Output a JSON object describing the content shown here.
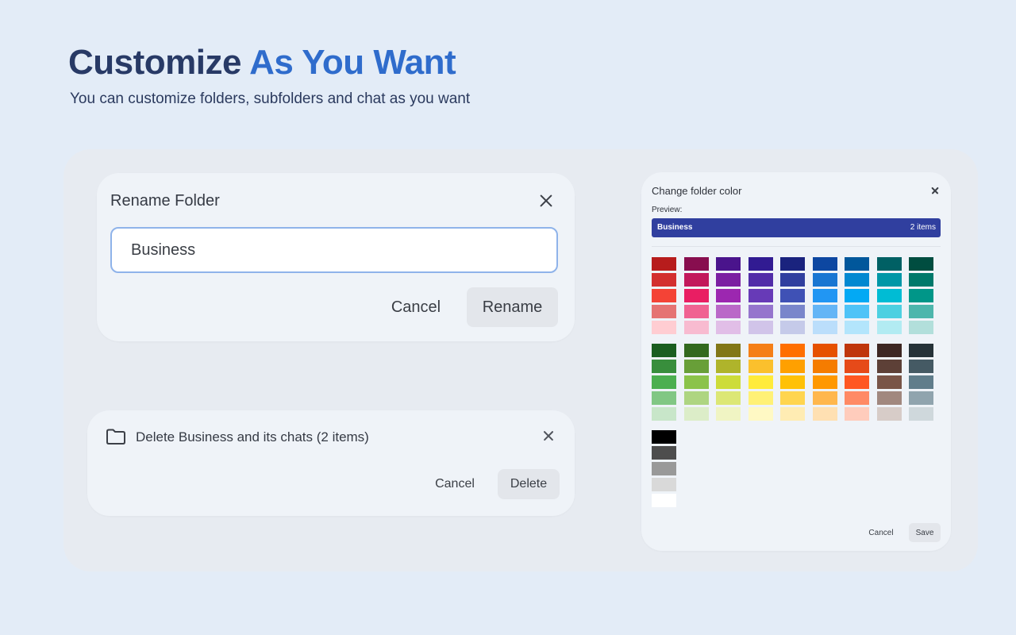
{
  "hero": {
    "title_part1": "Customize",
    "title_part2": "As You Want",
    "subtitle": "You can customize folders, subfolders and chat as you want"
  },
  "rename_dialog": {
    "title": "Rename Folder",
    "input_value": "Business",
    "cancel_label": "Cancel",
    "confirm_label": "Rename"
  },
  "delete_dialog": {
    "title": "Delete Business and its chats (2 items)",
    "cancel_label": "Cancel",
    "confirm_label": "Delete"
  },
  "color_dialog": {
    "title": "Change folder color",
    "preview_label": "Preview:",
    "preview_name": "Business",
    "preview_count": "2 items",
    "preview_color": "#303f9f",
    "cancel_label": "Cancel",
    "save_label": "Save",
    "palette_1": [
      [
        "#b71c1c",
        "#d32f2f",
        "#f44336",
        "#e57373",
        "#ffcdd2"
      ],
      [
        "#880e4f",
        "#c2185b",
        "#e91e63",
        "#f06292",
        "#f8bbd0"
      ],
      [
        "#4a148c",
        "#7b1fa2",
        "#9c27b0",
        "#ba68c8",
        "#e1bee7"
      ],
      [
        "#311b92",
        "#512da8",
        "#673ab7",
        "#9575cd",
        "#d1c4e9"
      ],
      [
        "#1a237e",
        "#303f9f",
        "#3f51b5",
        "#7986cb",
        "#c5cae9"
      ],
      [
        "#0d47a1",
        "#1976d2",
        "#2196f3",
        "#64b5f6",
        "#bbdefb"
      ],
      [
        "#01579b",
        "#0288d1",
        "#03a9f4",
        "#4fc3f7",
        "#b3e5fc"
      ],
      [
        "#006064",
        "#0097a7",
        "#00bcd4",
        "#4dd0e1",
        "#b2ebf2"
      ],
      [
        "#004d40",
        "#00796b",
        "#009688",
        "#4db6ac",
        "#b2dfdb"
      ]
    ],
    "palette_2": [
      [
        "#1b5e20",
        "#388e3c",
        "#4caf50",
        "#81c784",
        "#c8e6c9"
      ],
      [
        "#33691e",
        "#689f38",
        "#8bc34a",
        "#aed581",
        "#dcedc8"
      ],
      [
        "#827717",
        "#afb42b",
        "#cddc39",
        "#dce775",
        "#f0f4c3"
      ],
      [
        "#f57f17",
        "#fbc02d",
        "#ffeb3b",
        "#fff176",
        "#fff9c4"
      ],
      [
        "#ff6f00",
        "#ffa000",
        "#ffc107",
        "#ffd54f",
        "#ffecb3"
      ],
      [
        "#e65100",
        "#f57c00",
        "#ff9800",
        "#ffb74d",
        "#ffe0b2"
      ],
      [
        "#bf360c",
        "#e64a19",
        "#ff5722",
        "#ff8a65",
        "#ffccbc"
      ],
      [
        "#3e2723",
        "#5d4037",
        "#795548",
        "#a1887f",
        "#d7ccc8"
      ],
      [
        "#263238",
        "#455a64",
        "#607d8b",
        "#90a4ae",
        "#cfd8dc"
      ]
    ],
    "palette_3": [
      [
        "#000000",
        "#4d4d4d",
        "#999999",
        "#d9d9d9",
        "#ffffff"
      ]
    ]
  }
}
